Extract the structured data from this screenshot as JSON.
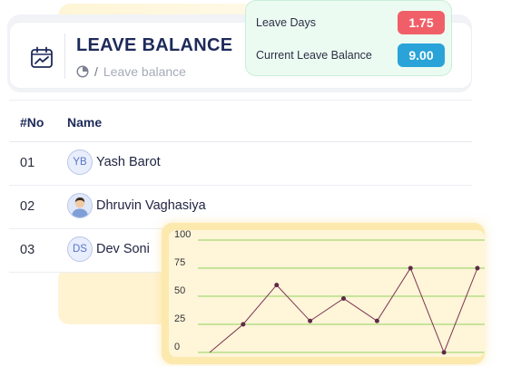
{
  "header": {
    "title": "LEAVE BALANCE",
    "breadcrumb": {
      "icon": "pie-chart-icon",
      "separator": "/",
      "current": "Leave balance"
    },
    "calendar_icon": "calendar-chart-icon"
  },
  "balance": {
    "leave_days_label": "Leave Days",
    "leave_days_value": "1.75",
    "current_label": "Current Leave Balance",
    "current_value": "9.00",
    "colors": {
      "leave_days": "#f05f68",
      "current": "#2aa3d8"
    }
  },
  "table": {
    "headers": {
      "no": "#No",
      "name": "Name"
    },
    "rows": [
      {
        "no": "01",
        "name": "Yash Barot",
        "avatar_initials": "YB"
      },
      {
        "no": "02",
        "name": "Dhruvin Vaghasiya",
        "avatar_icon": "person-photo-avatar"
      },
      {
        "no": "03",
        "name": "Dev Soni",
        "avatar_initials": "DS"
      }
    ]
  },
  "chart_data": {
    "type": "line",
    "y_ticks": [
      "100",
      "75",
      "50",
      "25",
      "0"
    ],
    "ylim": [
      0,
      100
    ],
    "grid": true,
    "series": [
      {
        "values": [
          0,
          25,
          60,
          28,
          48,
          28,
          75,
          0,
          75
        ]
      }
    ],
    "colors": {
      "line": "#7a3550",
      "grid": "#8fd35a"
    }
  }
}
